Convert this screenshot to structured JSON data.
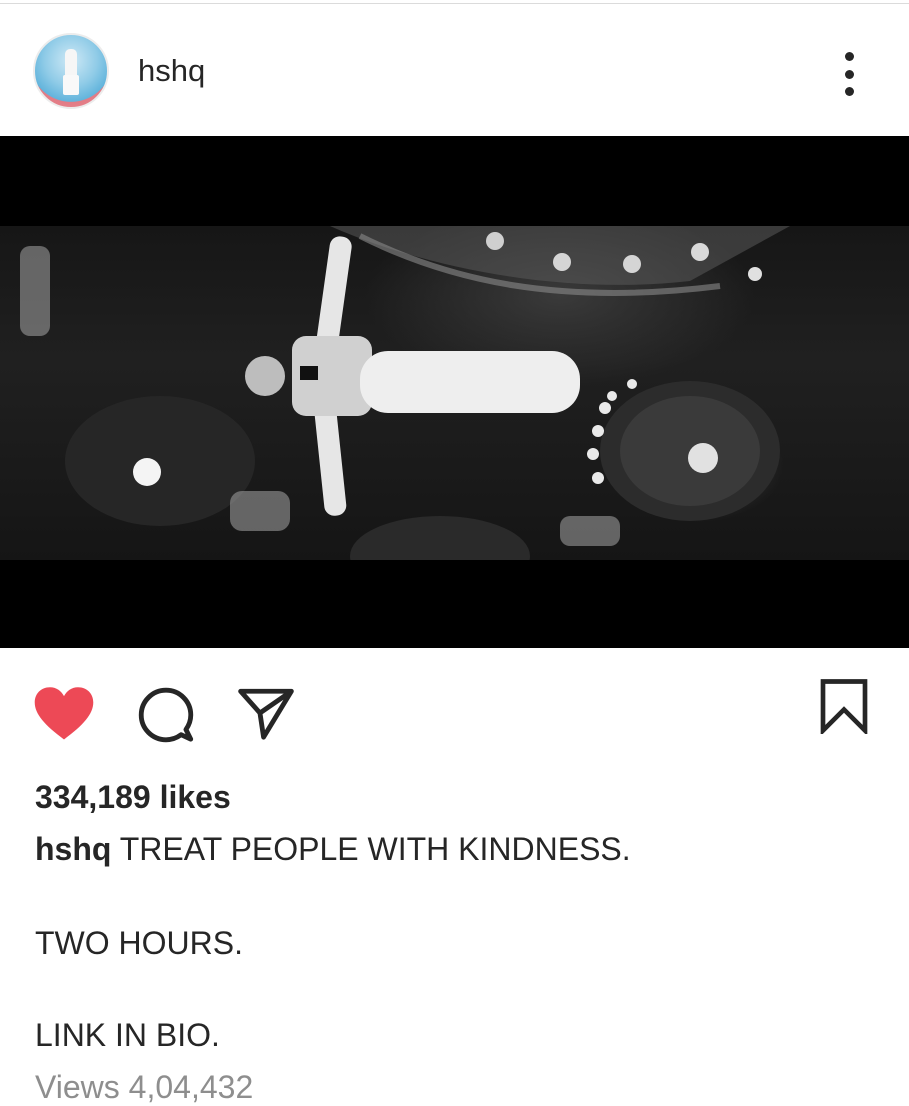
{
  "post": {
    "username": "hshq",
    "media_description": "black-and-white video frame",
    "likes_text": "334,189 likes",
    "caption_user": "hshq",
    "caption_lines": [
      "TREAT PEOPLE WITH KINDNESS.",
      "TWO HOURS.",
      "LINK IN BIO."
    ],
    "views_text": "Views 4,04,432"
  },
  "colors": {
    "like_red": "#ED4956",
    "text": "#262626",
    "muted": "#8E8E8E"
  },
  "icons": {
    "more": "more-vertical-icon",
    "like": "heart-filled-icon",
    "comment": "comment-bubble-icon",
    "share": "paper-plane-icon",
    "save": "bookmark-icon"
  }
}
